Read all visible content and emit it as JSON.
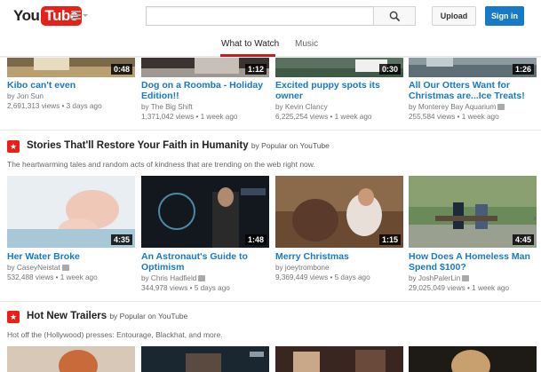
{
  "header": {
    "logo_you": "You",
    "logo_tube": "Tube",
    "search_placeholder": "",
    "upload_label": "Upload",
    "signin_label": "Sign in"
  },
  "tabs": [
    {
      "label": "What to Watch",
      "active": true
    },
    {
      "label": "Music",
      "active": false
    }
  ],
  "top_row": [
    {
      "title": "Kibo can't even",
      "channel": "by Jon Sun",
      "views": "2,691,313 views",
      "age": "3 days ago",
      "duration": "0:48",
      "verified": false
    },
    {
      "title": "Dog on a Roomba - Holiday Edition!!",
      "channel": "by The Big Shift",
      "views": "1,371,042 views",
      "age": "1 week ago",
      "duration": "1:12",
      "verified": false
    },
    {
      "title": "Excited puppy spots its owner",
      "channel": "by Kevin Clancy",
      "views": "6,225,254 views",
      "age": "1 week ago",
      "duration": "0:30",
      "verified": false
    },
    {
      "title": "All Our Otters Want for Christmas are...Ice Treats!",
      "channel": "by Monterey Bay Aquarium",
      "views": "255,584 views",
      "age": "1 week ago",
      "duration": "1:26",
      "verified": true
    }
  ],
  "shelves": [
    {
      "title": "Stories That'll Restore Your Faith in Humanity",
      "by": "by Popular on YouTube",
      "description": "The heartwarming tales and random acts of kindness that are trending on the web right now.",
      "videos": [
        {
          "title": "Her Water Broke",
          "channel": "by CaseyNeistat",
          "views": "532,488 views",
          "age": "1 week ago",
          "duration": "4:35",
          "verified": true
        },
        {
          "title": "An Astronaut's Guide to Optimism",
          "channel": "by Chris Hadfield",
          "views": "344,978 views",
          "age": "5 days ago",
          "duration": "1:48",
          "verified": true
        },
        {
          "title": "Merry Christmas",
          "channel": "by joeytrombone",
          "views": "9,369,449 views",
          "age": "5 days ago",
          "duration": "1:15",
          "verified": false
        },
        {
          "title": "How Does A Homeless Man Spend $100?",
          "channel": "by JoshPalerLin",
          "views": "29,025,049 views",
          "age": "1 week ago",
          "duration": "4:45",
          "verified": true
        }
      ]
    },
    {
      "title": "Hot New Trailers",
      "by": "by Popular on YouTube",
      "description": "Hot off the (Hollywood) presses: Entourage, Blackhat, and more."
    }
  ],
  "colors": {
    "brand_red": "#e62117",
    "link_blue": "#167ac6",
    "active_tab_underline": "#cc181e"
  }
}
